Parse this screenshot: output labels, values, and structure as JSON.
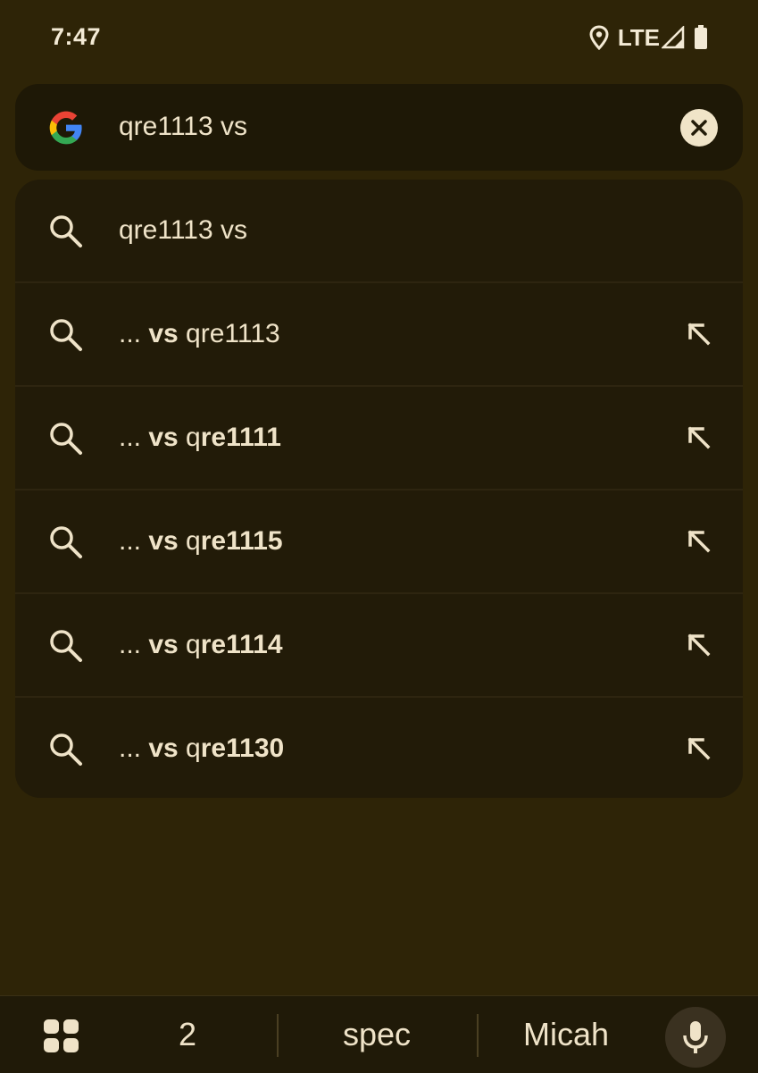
{
  "status_bar": {
    "time": "7:47",
    "network": "LTE"
  },
  "search": {
    "query": "qre1113 vs"
  },
  "suggestions": [
    {
      "prefix": "",
      "plain": "qre1113 vs",
      "bold": ""
    },
    {
      "prefix": "... ",
      "plain_before": "",
      "vs": "vs",
      "plain": " qre1113",
      "bold": ""
    },
    {
      "prefix": "... ",
      "vs": "vs",
      "plain": " q",
      "bold": "re1111"
    },
    {
      "prefix": "... ",
      "vs": "vs",
      "plain": " q",
      "bold": "re1115"
    },
    {
      "prefix": "... ",
      "vs": "vs",
      "plain": " q",
      "bold": "re1114"
    },
    {
      "prefix": "... ",
      "vs": "vs",
      "plain": " q",
      "bold": "re1130"
    }
  ],
  "keyboard_suggestions": [
    "2",
    "spec",
    "Micah"
  ],
  "colors": {
    "background": "#2e2407",
    "surface": "#221b08",
    "text": "#efe3c8"
  }
}
